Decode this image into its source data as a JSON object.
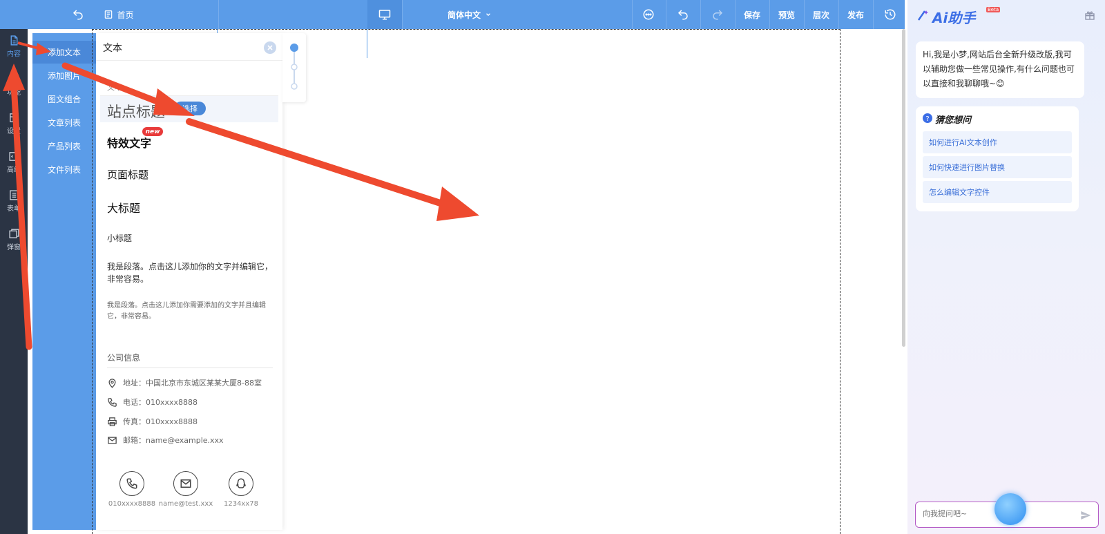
{
  "topbar": {
    "home": "首页",
    "language": "简体中文",
    "save": "保存",
    "preview": "预览",
    "layers": "层次",
    "publish": "发布",
    "icons": [
      "back-icon",
      "page-icon",
      "desktop-icon",
      "chevron-down-icon",
      "more-icon",
      "undo-icon",
      "redo-icon",
      "history-icon"
    ]
  },
  "rail": {
    "items": [
      {
        "label": "内容",
        "icon": "file-icon",
        "active": true
      },
      {
        "label": "功能",
        "icon": "function-icon"
      },
      {
        "label": "设置",
        "icon": "settings-icon"
      },
      {
        "label": "高级",
        "icon": "code-icon"
      },
      {
        "label": "表单",
        "icon": "form-icon"
      },
      {
        "label": "弹窗",
        "icon": "popup-icon"
      }
    ]
  },
  "submenu": {
    "items": [
      "添加文本",
      "添加图片",
      "图文组合",
      "文章列表",
      "产品列表",
      "文件列表"
    ]
  },
  "panel": {
    "title": "文本",
    "section": "文本",
    "select_badge": "选择",
    "new_badge": "new",
    "items": {
      "site_title": "站点标题",
      "special_text": "特效文字",
      "page_title": "页面标题",
      "big_title": "大标题",
      "sub_title": "小标题",
      "paragraph1": "我是段落。点击这儿添加你的文字并编辑它，非常容易。",
      "paragraph2": "我是段落。点击这儿添加你需要添加的文字并且编辑它，非常容易。"
    },
    "company": {
      "title": "公司信息",
      "address": "地址：中国北京市东城区某某大厦8-88室",
      "phone": "电话：010xxxx8888",
      "fax": "传真：010xxxx8888",
      "email": "邮箱：name@example.xxx"
    },
    "contacts": [
      {
        "icon": "phone-icon",
        "label": "010xxxx8888"
      },
      {
        "icon": "mail-icon",
        "label": "name@test.xxx"
      },
      {
        "icon": "qq-icon",
        "label": "1234xx78"
      }
    ]
  },
  "ai": {
    "logo": "Ai助手",
    "beta": "Beta",
    "greeting": "Hi,我是小梦,网站后台全新升级改版,我可以辅助您做一些常见操作,有什么问题也可以直接和我聊聊哦~😊",
    "guess_title": "猜您想问",
    "questions": [
      "如何进行AI文本创作",
      "如何快速进行图片替换",
      "怎么编辑文字控件"
    ],
    "input_placeholder": "向我提问吧~"
  },
  "colors": {
    "topbar": "#5b9ce8",
    "rail": "#2b3444",
    "annotation_arrow": "#ee4a2f"
  }
}
